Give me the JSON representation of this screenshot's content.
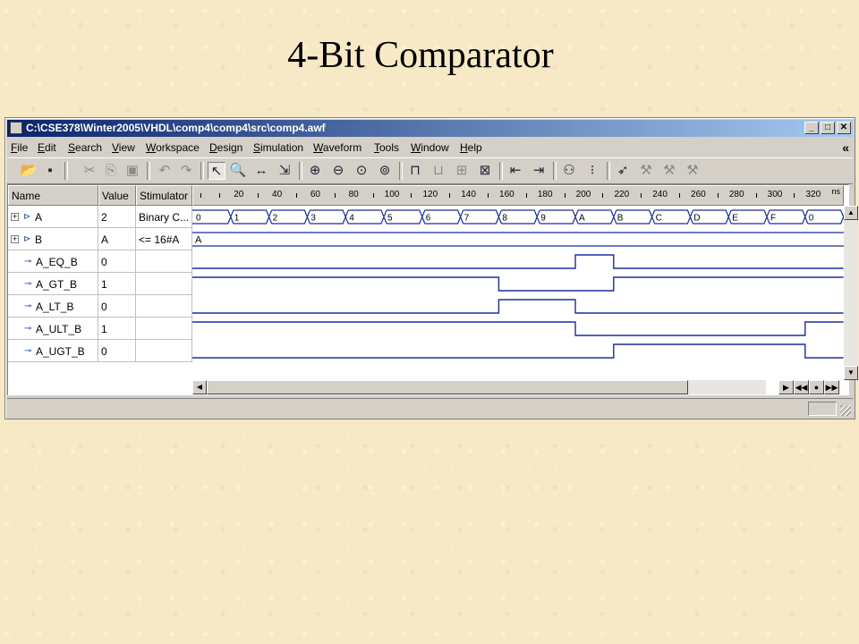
{
  "slide": {
    "title": "4-Bit Comparator"
  },
  "window": {
    "title": "C:\\CSE378\\Winter2005\\VHDL\\comp4\\comp4\\src\\comp4.awf",
    "minimize": "_",
    "maximize": "□",
    "close": "✕"
  },
  "menu": [
    "File",
    "Edit",
    "Search",
    "View",
    "Workspace",
    "Design",
    "Simulation",
    "Waveform",
    "Tools",
    "Window",
    "Help"
  ],
  "menu_chevron": "«",
  "toolbar_icons": [
    "open-folder-icon",
    "save-icon",
    "cut-icon",
    "copy-icon",
    "paste-icon",
    "undo-icon",
    "redo-icon",
    "select-pointer-icon",
    "zoom-icon",
    "measure-icon",
    "cursor-select-icon",
    "zoom-in-icon",
    "zoom-out-icon",
    "zoom-fit-icon",
    "zoom-area-icon",
    "add-signal-icon",
    "remove-signal-icon",
    "group-icon",
    "stimulator-icon",
    "prev-edge-icon",
    "next-edge-icon",
    "find-icon",
    "footsteps-icon",
    "breakpoint-icon",
    "run-icon",
    "step-icon",
    "stop-icon"
  ],
  "columns": {
    "name": "Name",
    "value": "Value",
    "stimulator": "Stimulator"
  },
  "timeline": {
    "unit": "ns",
    "labels": [
      "20",
      "40",
      "60",
      "80",
      "100",
      "120",
      "140",
      "160",
      "180",
      "200",
      "220",
      "240",
      "260",
      "280",
      "300",
      "320"
    ]
  },
  "signals": [
    {
      "name": "A",
      "value": "2",
      "stimulator": "Binary C...",
      "expandable": true,
      "expand_glyph": "+",
      "icon": "input-port-icon",
      "icon_glyph": "⊳",
      "bus": [
        "0",
        "1",
        "2",
        "3",
        "4",
        "5",
        "6",
        "7",
        "8",
        "9",
        "A",
        "B",
        "C",
        "D",
        "E",
        "F",
        "0"
      ]
    },
    {
      "name": "B",
      "value": "A",
      "stimulator": "<= 16#A",
      "expandable": true,
      "expand_glyph": "+",
      "icon": "input-port-icon",
      "icon_glyph": "⊳",
      "bus": [
        "A"
      ]
    },
    {
      "name": "A_EQ_B",
      "value": "0",
      "stimulator": "",
      "expandable": false,
      "icon": "output-port-icon",
      "icon_glyph": "⊸",
      "bits": [
        0,
        0,
        0,
        0,
        0,
        0,
        0,
        0,
        0,
        0,
        1,
        0,
        0,
        0,
        0,
        0,
        0
      ]
    },
    {
      "name": "A_GT_B",
      "value": "1",
      "stimulator": "",
      "expandable": false,
      "icon": "output-port-icon",
      "icon_glyph": "⊸",
      "bits": [
        1,
        1,
        1,
        1,
        1,
        1,
        1,
        1,
        0,
        0,
        0,
        1,
        1,
        1,
        1,
        1,
        1
      ]
    },
    {
      "name": "A_LT_B",
      "value": "0",
      "stimulator": "",
      "expandable": false,
      "icon": "output-port-icon",
      "icon_glyph": "⊸",
      "bits": [
        0,
        0,
        0,
        0,
        0,
        0,
        0,
        0,
        1,
        1,
        0,
        0,
        0,
        0,
        0,
        0,
        0
      ]
    },
    {
      "name": "A_ULT_B",
      "value": "1",
      "stimulator": "",
      "expandable": false,
      "icon": "output-port-icon",
      "icon_glyph": "⊸",
      "bits": [
        1,
        1,
        1,
        1,
        1,
        1,
        1,
        1,
        1,
        1,
        0,
        0,
        0,
        0,
        0,
        0,
        1
      ]
    },
    {
      "name": "A_UGT_B",
      "value": "0",
      "stimulator": "",
      "expandable": false,
      "icon": "output-port-icon",
      "icon_glyph": "⊸",
      "bits": [
        0,
        0,
        0,
        0,
        0,
        0,
        0,
        0,
        0,
        0,
        0,
        1,
        1,
        1,
        1,
        1,
        0
      ]
    }
  ],
  "scroll_glyphs": {
    "up": "▲",
    "down": "▼",
    "left": "◀",
    "play": "▶",
    "rewind": "◀◀",
    "stop": "●",
    "forward": "▶▶"
  },
  "colors": {
    "wave": "#1a2e9c",
    "titlebar": "#0a246a",
    "background": "#f7e9c6"
  }
}
